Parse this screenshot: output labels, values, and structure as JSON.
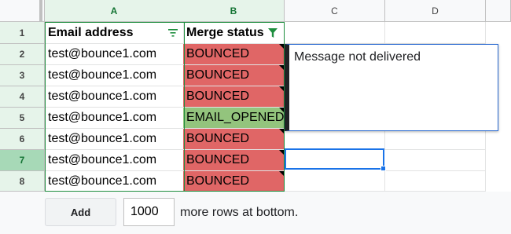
{
  "columns": [
    "A",
    "B",
    "C",
    "D"
  ],
  "rows": [
    "1",
    "2",
    "3",
    "4",
    "5",
    "6",
    "7",
    "8"
  ],
  "header": {
    "col_a": "Email address",
    "col_b": "Merge status"
  },
  "emails": [
    "test@bounce1.com",
    "test@bounce1.com",
    "test@bounce1.com",
    "test@bounce1.com",
    "test@bounce1.com",
    "test@bounce1.com",
    "test@bounce1.com"
  ],
  "statuses": [
    "BOUNCED",
    "BOUNCED",
    "BOUNCED",
    "EMAIL_OPENED",
    "BOUNCED",
    "BOUNCED",
    "BOUNCED"
  ],
  "note": {
    "text": "Message not delivered"
  },
  "footer": {
    "add_label": "Add",
    "rows_value": "1000",
    "more_label": "more rows at bottom."
  },
  "colors": {
    "bounced": "#e06666",
    "opened": "#93c47d",
    "selection": "#1a73e8",
    "header_selected": "#e6f4ea"
  }
}
